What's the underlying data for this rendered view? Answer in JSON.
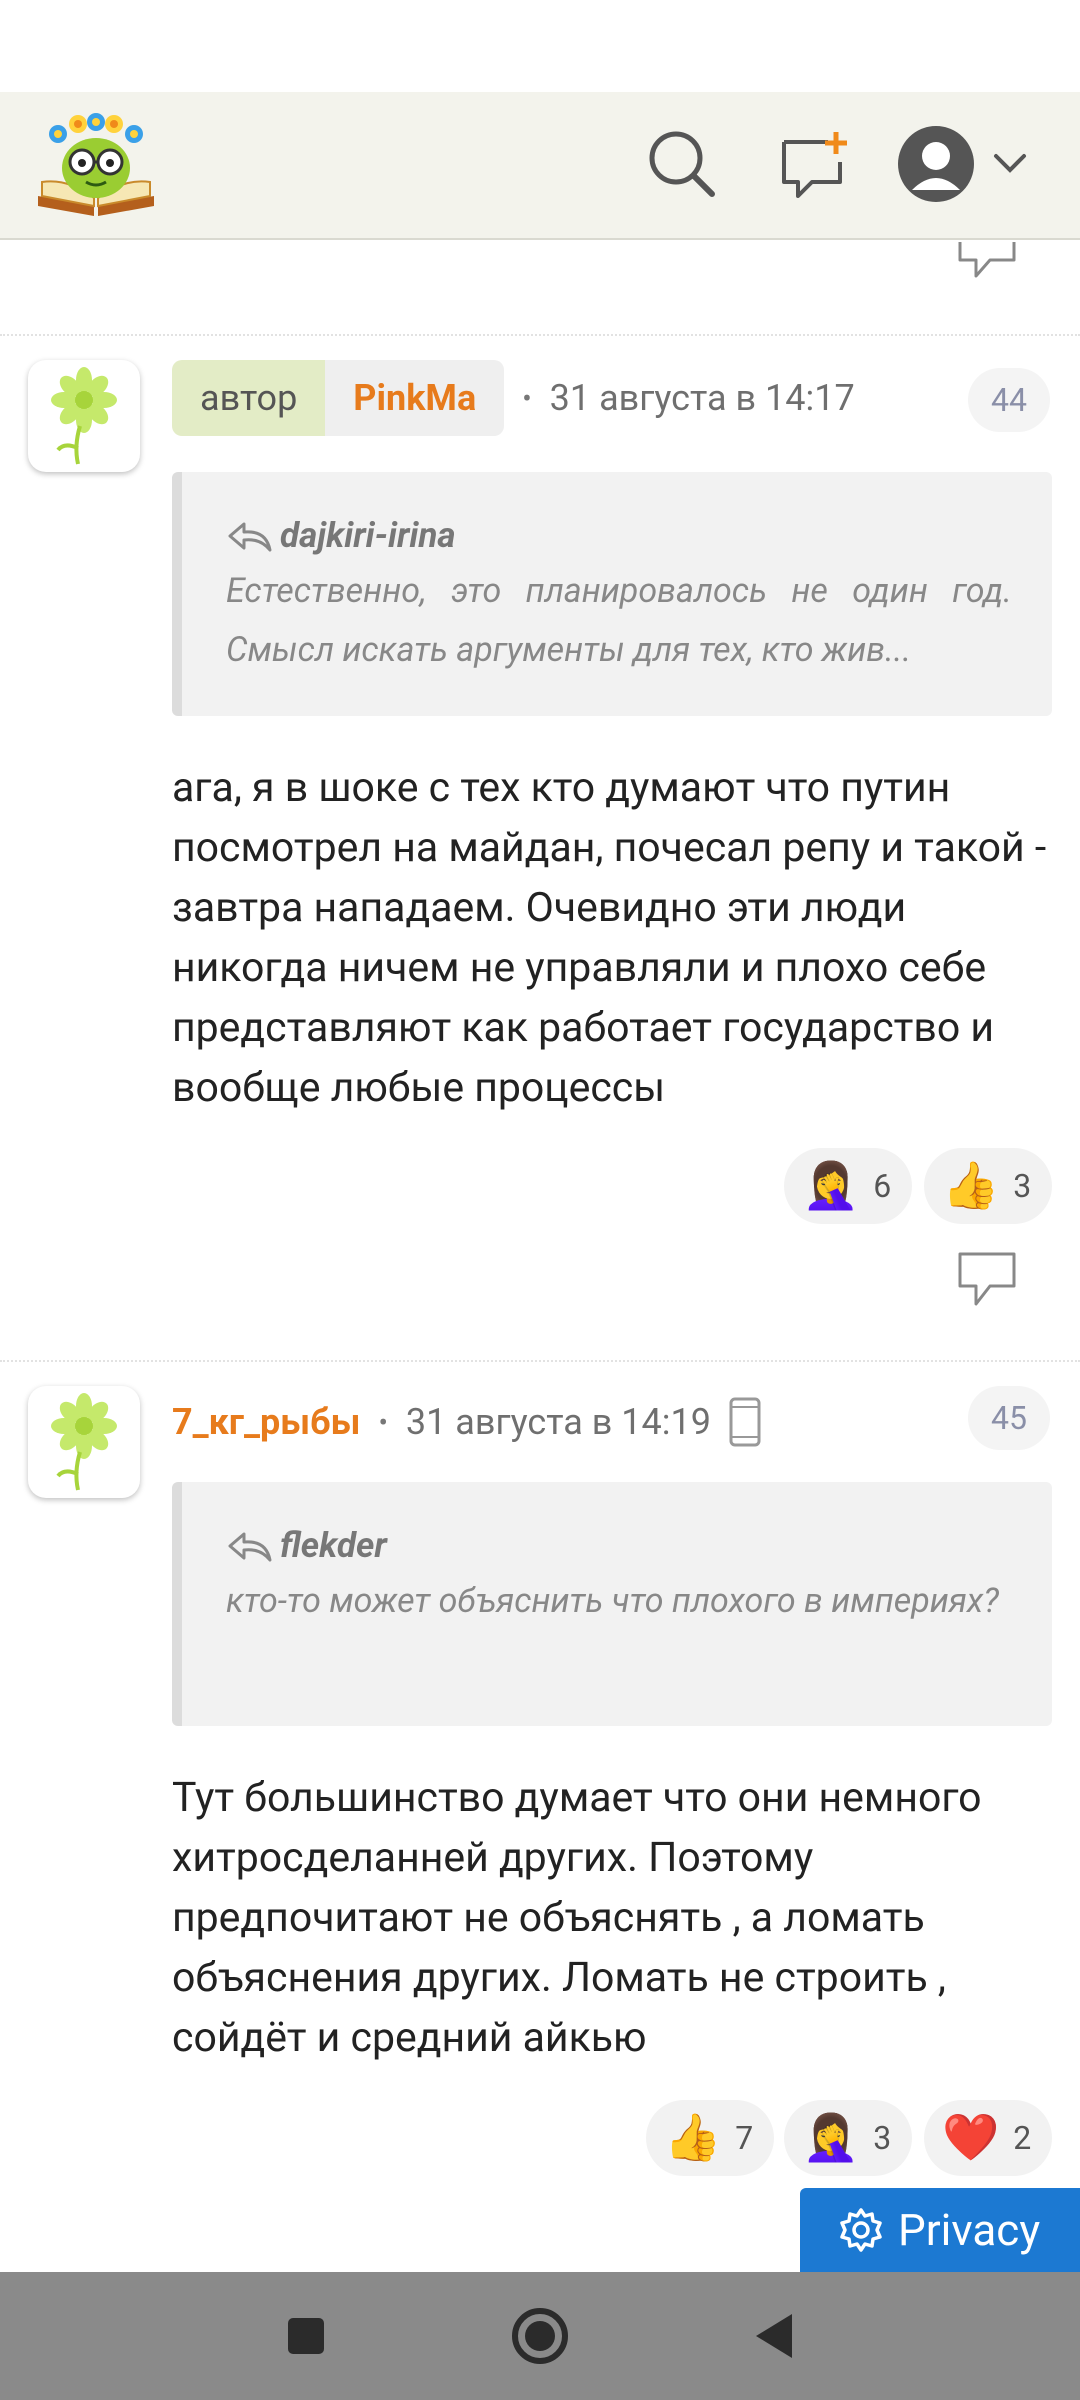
{
  "comments": [
    {
      "author_label": "автор",
      "username": "PinkMa",
      "timestamp": "31 августа в 14:17",
      "number": "44",
      "quote": {
        "user": "dajkiri-irina",
        "text": "Естественно, это планировалось не один год. Смысл искать аргументы для тех, кто жив..."
      },
      "body": "ага, я в шоке с тех кто думают что путин посмотрел на майдан, почесал репу и такой - завтра нападаем. Очевидно эти люди никогда ничем не управляли и плохо себе представляют как работает государство и вообще любые процессы",
      "reactions": [
        {
          "emoji": "🤦‍♀️",
          "count": "6"
        },
        {
          "emoji": "👍",
          "count": "3"
        }
      ]
    },
    {
      "username": "7_кг_рыбы",
      "timestamp": "31 августа в 14:19",
      "number": "45",
      "quote": {
        "user": "flekder",
        "text": "кто-то может объяснить что плохого в империях?"
      },
      "body": "Тут большинство думает что они немного хитросделанней других. Поэтому предпочитают не объяснять , а ломать объяснения других. Ломать не строить , сойдёт и средний айкью",
      "reactions": [
        {
          "emoji": "👍",
          "count": "7"
        },
        {
          "emoji": "🤦‍♀️",
          "count": "3"
        },
        {
          "emoji": "❤️",
          "count": "2"
        }
      ]
    }
  ],
  "privacy_label": "Privacy",
  "icons": {
    "search": "search-icon",
    "new_message": "new-message-icon",
    "profile": "profile-icon",
    "reply": "reply-icon",
    "mobile": "mobile-device-icon"
  },
  "colors": {
    "username": "#e77b1c",
    "header_bg": "#f3f3ec",
    "privacy_bg": "#1c79d2"
  }
}
